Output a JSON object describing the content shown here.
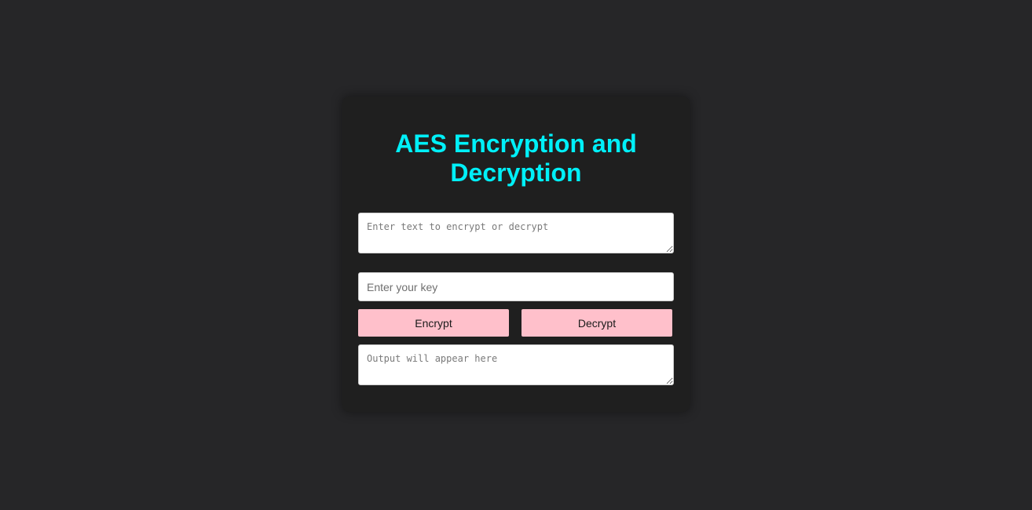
{
  "app": {
    "title": "AES Encryption and Decryption"
  },
  "form": {
    "text_placeholder": "Enter text to encrypt or decrypt",
    "text_value": "",
    "key_placeholder": "Enter your key",
    "key_value": "",
    "encrypt_label": "Encrypt",
    "decrypt_label": "Decrypt",
    "output_placeholder": "Output will appear here",
    "output_value": ""
  },
  "colors": {
    "background": "#262628",
    "card": "#1f1f1f",
    "title": "#00f0f8",
    "button": "#ffc0cb"
  }
}
